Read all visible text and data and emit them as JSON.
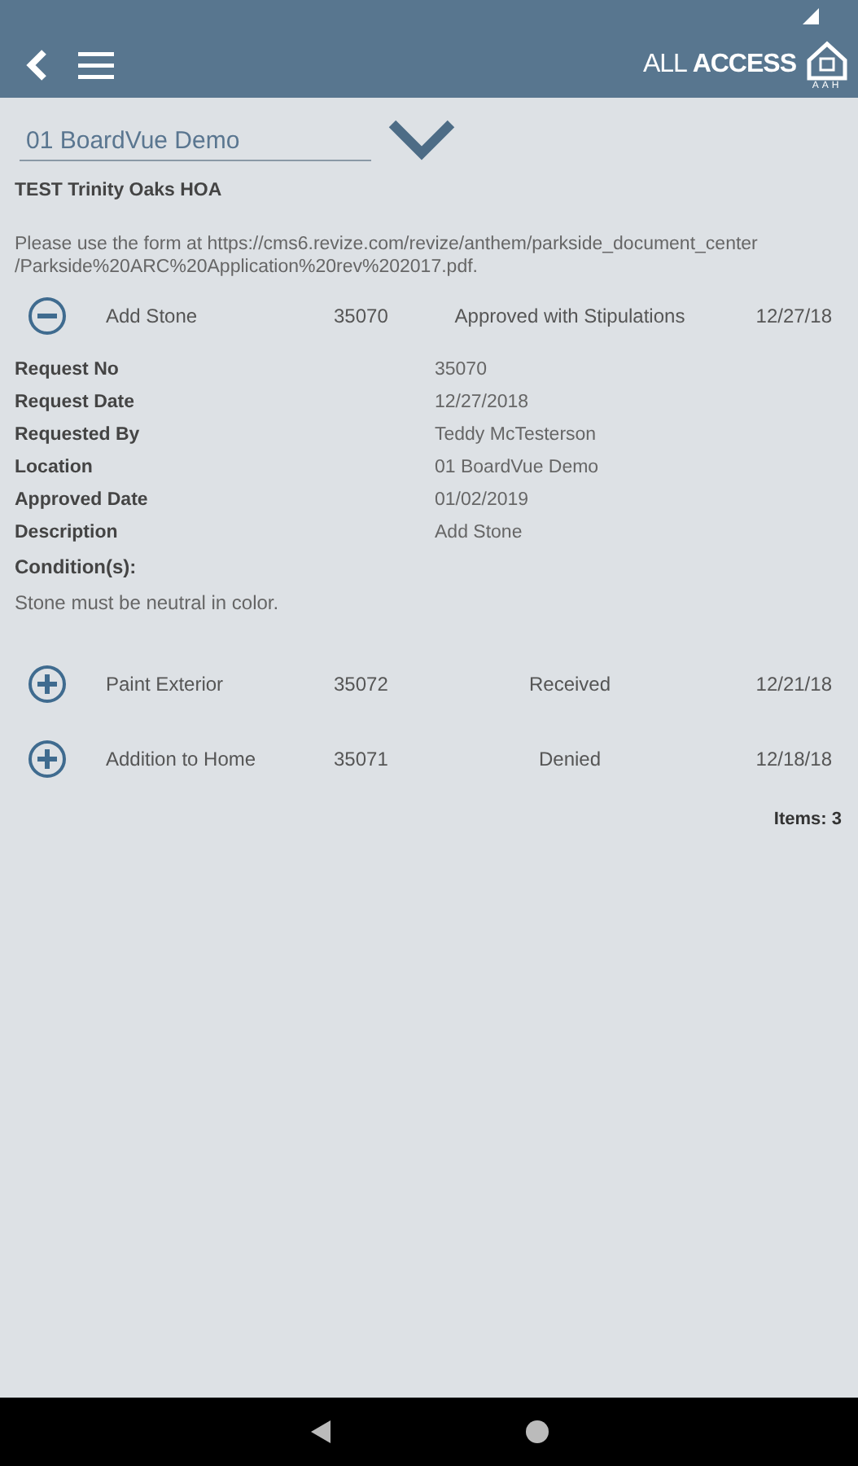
{
  "header": {
    "brand_light": "ALL",
    "brand_bold": "ACCESS",
    "logo_caption": "AAH"
  },
  "location_select": {
    "value": "01 BoardVue Demo"
  },
  "association": "TEST Trinity Oaks HOA",
  "notice_lines": [
    "Please use the form at https://cms6.revize.com/revize/anthem/parkside_document_center",
    "/Parkside%20ARC%20Application%20rev%202017.pdf."
  ],
  "requests": [
    {
      "title": "Add Stone",
      "number": "35070",
      "status": "Approved with Stipulations",
      "date": "12/27/18",
      "expanded": true,
      "details": [
        {
          "label": "Request No",
          "value": "35070"
        },
        {
          "label": "Request Date",
          "value": "12/27/2018"
        },
        {
          "label": "Requested By",
          "value": "Teddy McTesterson"
        },
        {
          "label": "Location",
          "value": "01 BoardVue Demo"
        },
        {
          "label": "Approved Date",
          "value": "01/02/2019"
        },
        {
          "label": "Description",
          "value": "Add Stone"
        }
      ],
      "conditions_label": "Condition(s):",
      "conditions": "Stone must be neutral in color."
    },
    {
      "title": "Paint Exterior",
      "number": "35072",
      "status": "Received",
      "date": "12/21/18",
      "expanded": false
    },
    {
      "title": "Addition to Home",
      "number": "35071",
      "status": "Denied",
      "date": "12/18/18",
      "expanded": false
    }
  ],
  "items_count": "Items: 3"
}
